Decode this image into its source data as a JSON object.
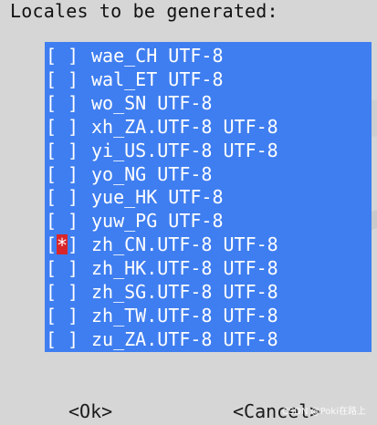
{
  "prompt": "Locales to be generated:",
  "locales": [
    {
      "label": "wae_CH UTF-8",
      "mark": " "
    },
    {
      "label": "wal_ET UTF-8",
      "mark": " "
    },
    {
      "label": "wo_SN UTF-8",
      "mark": " "
    },
    {
      "label": "xh_ZA.UTF-8 UTF-8",
      "mark": " "
    },
    {
      "label": "yi_US.UTF-8 UTF-8",
      "mark": " "
    },
    {
      "label": "yo_NG UTF-8",
      "mark": " "
    },
    {
      "label": "yue_HK UTF-8",
      "mark": " "
    },
    {
      "label": "yuw_PG UTF-8",
      "mark": " "
    },
    {
      "label": "zh_CN.UTF-8 UTF-8",
      "mark": "*"
    },
    {
      "label": "zh_HK.UTF-8 UTF-8",
      "mark": " "
    },
    {
      "label": "zh_SG.UTF-8 UTF-8",
      "mark": " "
    },
    {
      "label": "zh_TW.UTF-8 UTF-8",
      "mark": " "
    },
    {
      "label": "zu_ZA.UTF-8 UTF-8",
      "mark": " "
    }
  ],
  "checkbox_open": "[",
  "checkbox_close": "]",
  "buttons": {
    "ok": "<Ok>",
    "cancel": "<Cancel>"
  },
  "watermark": "CSDN @Poki在路上",
  "colors": {
    "list_background": "#3f7ef0",
    "checked_highlight": "#d9262b",
    "screen_background": "#d6d6d6"
  }
}
